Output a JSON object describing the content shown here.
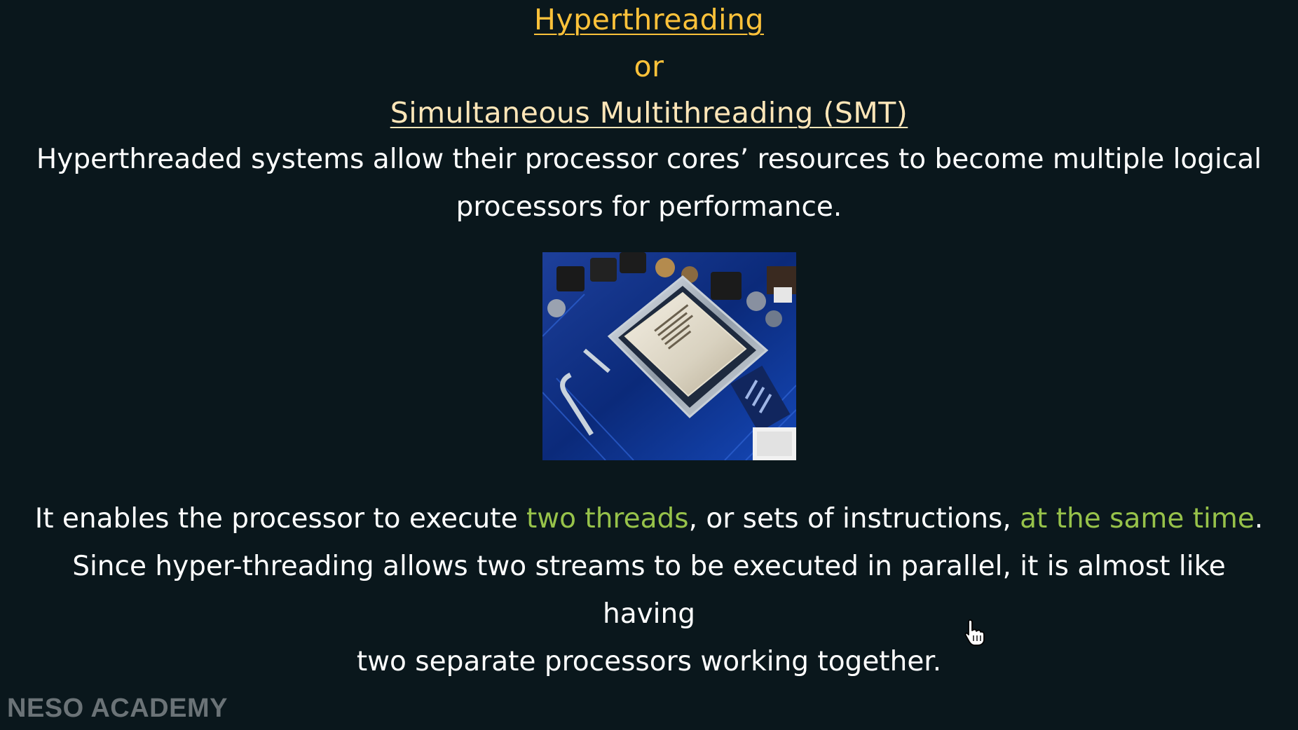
{
  "slide": {
    "title": "Hyperthreading",
    "or_text": "or",
    "subtitle": "Simultaneous Multithreading (SMT)",
    "intro": {
      "line1": "Hyperthreaded systems allow their processor cores’ resources to become multiple logical",
      "line2": "processors for performance."
    },
    "body": {
      "s1_a": "It enables the processor to execute ",
      "s1_hl1": "two threads",
      "s1_b": ", or sets of instructions, ",
      "s1_hl2": "at the same time",
      "s1_c": ".",
      "line2": "Since hyper-threading allows two streams to be executed in parallel, it is almost like having",
      "line3": "two separate processors working together."
    },
    "image_label": "cpu-on-motherboard-photo",
    "watermark": "NESO ACADEMY"
  },
  "colors": {
    "background": "#0a171c",
    "title": "#ffc23a",
    "subtitle": "#ffe6b8",
    "highlight": "#97c24a",
    "text": "#ffffff"
  }
}
